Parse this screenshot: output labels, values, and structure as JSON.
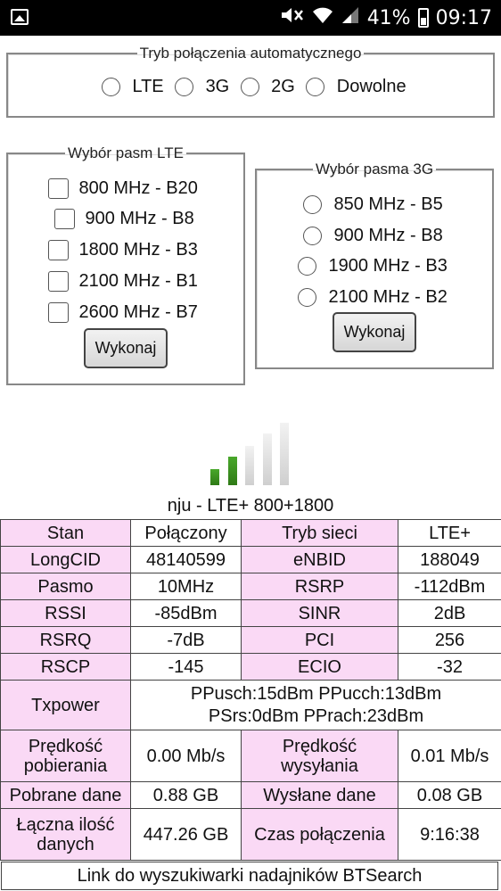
{
  "status_bar": {
    "battery": "41%",
    "time": "09:17",
    "icons": [
      "image-icon",
      "mute-icon",
      "wifi-icon",
      "signal-icon",
      "battery-icon"
    ]
  },
  "mode": {
    "legend": "Tryb połączenia automatycznego",
    "options": [
      "LTE",
      "3G",
      "2G",
      "Dowolne"
    ]
  },
  "lte_bands": {
    "legend": "Wybór pasm LTE",
    "options": [
      "800 MHz - B20",
      "900 MHz - B8",
      "1800 MHz - B3",
      "2100 MHz - B1",
      "2600 MHz - B7"
    ],
    "button": "Wykonaj"
  },
  "umts_bands": {
    "legend": "Wybór pasma 3G",
    "options": [
      "850 MHz - B5",
      "900 MHz - B8",
      "1900 MHz - B3",
      "2100 MHz - B2"
    ],
    "button": "Wykonaj"
  },
  "signal": {
    "level": 2,
    "max": 5,
    "active_color": "#49a82b",
    "inactive_color": "#cfcfcf"
  },
  "network": "nju - LTE+ 800+1800",
  "table": {
    "rows": [
      [
        "Stan",
        "Połączony",
        "Tryb sieci",
        "LTE+"
      ],
      [
        "LongCID",
        "48140599",
        "eNBID",
        "188049"
      ],
      [
        "Pasmo",
        "10MHz",
        "RSRP",
        "-112dBm"
      ],
      [
        "RSSI",
        "-85dBm",
        "SINR",
        "2dB"
      ],
      [
        "RSRQ",
        "-7dB",
        "PCI",
        "256"
      ],
      [
        "RSCP",
        "-145",
        "ECIO",
        "-32"
      ]
    ],
    "txpower_label": "Txpower",
    "txpower_line1": "PPusch:15dBm PPucch:13dBm",
    "txpower_line2": "PSrs:0dBm PPrach:23dBm",
    "speed": [
      "Prędkość pobierania",
      "0.00 Mb/s",
      "Prędkość wysyłania",
      "0.01 Mb/s"
    ],
    "data_row": [
      "Pobrane dane",
      "0.88 GB",
      "Wysłane dane",
      "0.08 GB"
    ],
    "total_row": [
      "Łączna ilość danych",
      "447.26 GB",
      "Czas połączenia",
      "9:16:38"
    ]
  },
  "link": "Link do wyszukiwarki nadajników BTSearch",
  "colors": {
    "label_bg": "#fad9f5"
  }
}
